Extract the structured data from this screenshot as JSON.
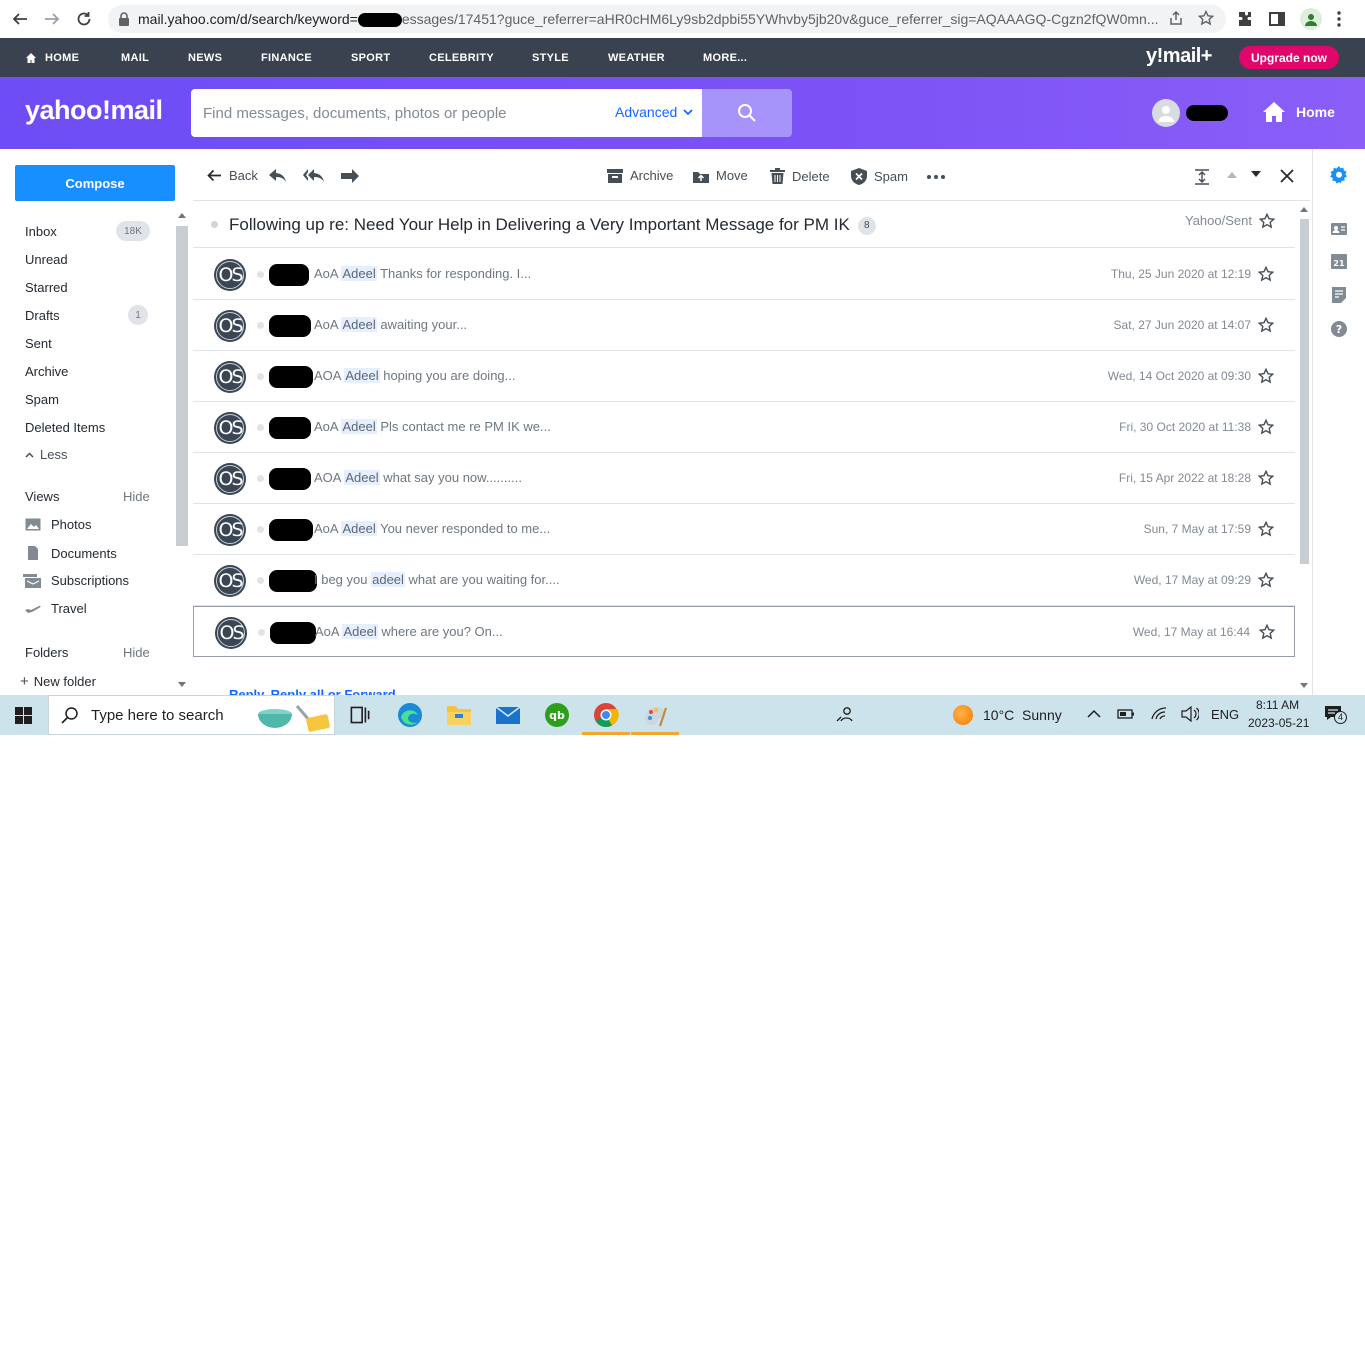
{
  "browser": {
    "url_prefix": "mail.yahoo.com/d/search/keyword=",
    "url_suffix": "essages/17451?guce_referrer=aHR0cHM6Ly9sb2dpbi55YWhvby5jb20v&guce_referrer_sig=AQAAAGQ-Cgzn2fQW0mn..."
  },
  "topnav": {
    "items": [
      "HOME",
      "MAIL",
      "NEWS",
      "FINANCE",
      "SPORT",
      "CELEBRITY",
      "STYLE",
      "WEATHER",
      "MORE..."
    ],
    "brand": "y!mail+",
    "upgrade": "Upgrade now"
  },
  "header": {
    "logo": "yahoo!mail",
    "search_placeholder": "Find messages, documents, photos or people",
    "advanced": "Advanced",
    "home": "Home"
  },
  "sidebar": {
    "compose": "Compose",
    "folders": [
      {
        "label": "Inbox",
        "badge": "18K"
      },
      {
        "label": "Unread",
        "badge": ""
      },
      {
        "label": "Starred",
        "badge": ""
      },
      {
        "label": "Drafts",
        "badge": "1"
      },
      {
        "label": "Sent",
        "badge": ""
      },
      {
        "label": "Archive",
        "badge": ""
      },
      {
        "label": "Spam",
        "badge": ""
      },
      {
        "label": "Deleted Items",
        "badge": ""
      }
    ],
    "less": "Less",
    "views_title": "Views",
    "views_hide": "Hide",
    "views": [
      "Photos",
      "Documents",
      "Subscriptions",
      "Travel"
    ],
    "folders_title": "Folders",
    "folders_hide": "Hide",
    "new_folder": "New folder"
  },
  "toolbar": {
    "back": "Back",
    "archive": "Archive",
    "move": "Move",
    "delete": "Delete",
    "spam": "Spam"
  },
  "thread": {
    "subject": "Following up re: Need Your Help in Delivering a Very Important Message for PM IK",
    "count": "8",
    "folder": "Yahoo/Sent",
    "messages": [
      {
        "pre": "AoA ",
        "hl": "Adeel",
        "post": " Thanks for responding. I...",
        "date": "Thu, 25 Jun 2020 at 12:19"
      },
      {
        "pre": "AoA ",
        "hl": "Adeel",
        "post": " awaiting your...",
        "date": "Sat, 27 Jun 2020 at 14:07"
      },
      {
        "pre": "AOA ",
        "hl": "Adeel",
        "post": " hoping you are doing...",
        "date": "Wed, 14 Oct 2020 at 09:30"
      },
      {
        "pre": "AoA ",
        "hl": "Adeel",
        "post": " Pls contact me re PM IK we...",
        "date": "Fri, 30 Oct 2020 at 11:38"
      },
      {
        "pre": "AOA ",
        "hl": "Adeel",
        "post": " what say you now..........",
        "date": "Fri, 15 Apr 2022 at 18:28"
      },
      {
        "pre": "AoA ",
        "hl": "Adeel",
        "post": " You never responded to me...",
        "date": "Sun, 7 May at 17:59"
      },
      {
        "pre": "I beg you ",
        "hl": "adeel",
        "post": " what are you waiting for....",
        "date": "Wed, 17 May at 09:29"
      },
      {
        "pre": "AoA ",
        "hl": "Adeel",
        "post": " where are you? On...",
        "date": "Wed, 17 May at 16:44"
      }
    ],
    "avatar_initials": "OS",
    "reply_links": "Reply, Reply all or Forward"
  },
  "taskbar": {
    "search": "Type here to search",
    "weather": "10°C  Sunny",
    "lang": "ENG",
    "time": "8:11 AM",
    "date": "2023-05-21",
    "notif": "4"
  },
  "colors": {
    "yahoo_purple": "#6d4df5",
    "compose_blue": "#188fff",
    "upgrade_pink": "#e0066b",
    "nav_dark": "#39424e"
  }
}
